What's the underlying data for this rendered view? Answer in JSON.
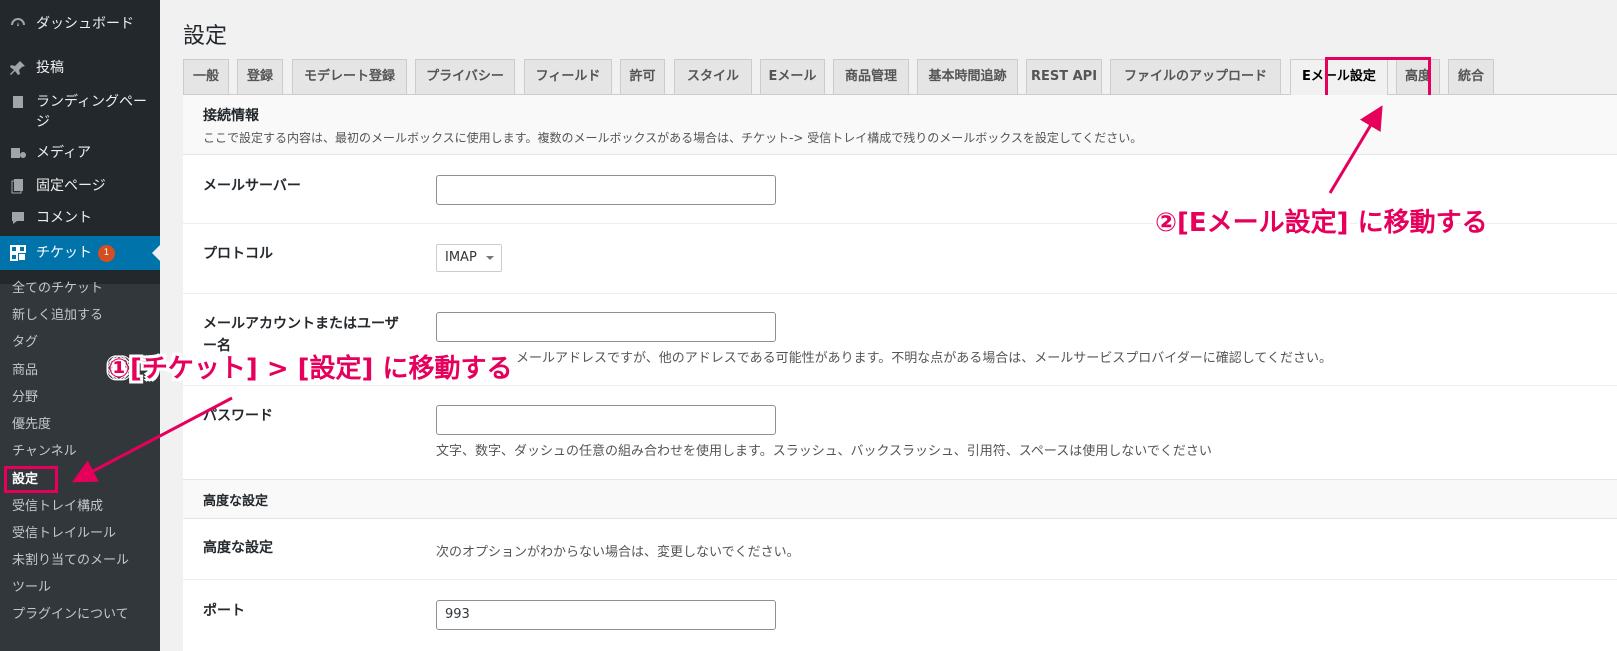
{
  "sidebar": {
    "items": [
      {
        "label": "ダッシュボード",
        "icon": "dashboard-icon"
      },
      {
        "label": "投稿",
        "icon": "pin-icon"
      },
      {
        "label": "ランディングページ",
        "icon": "page-icon"
      },
      {
        "label": "メディア",
        "icon": "media-icon"
      },
      {
        "label": "固定ページ",
        "icon": "pages-icon"
      },
      {
        "label": "コメント",
        "icon": "comment-icon"
      },
      {
        "label": "チケット",
        "icon": "ticket-icon",
        "badge": "1"
      }
    ],
    "submenu": [
      "全てのチケット",
      "新しく追加する",
      "タグ",
      "商品",
      "分野",
      "優先度",
      "チャンネル",
      "設定",
      "受信トレイ構成",
      "受信トレイルール",
      "未割り当てのメール",
      "ツール",
      "プラグインについて"
    ]
  },
  "page": {
    "title": "設定"
  },
  "tabs": [
    "一般",
    "登録",
    "モデレート登録",
    "プライバシー",
    "フィールド",
    "許可",
    "スタイル",
    "Eメール",
    "商品管理",
    "基本時間追跡",
    "REST API",
    "ファイルのアップロード",
    "Eメール設定",
    "高度",
    "統合"
  ],
  "active_tab": "Eメール設定",
  "sections": {
    "connection": {
      "title": "接続情報",
      "desc": "ここで設定する内容は、最初のメールボックスに使用します。複数のメールボックスがある場合は、チケット-> 受信トレイ構成で残りのメールボックスを設定してください。"
    },
    "advanced": {
      "title": "高度な設定"
    }
  },
  "fields": {
    "mail_server": {
      "label": "メールサーバー",
      "value": ""
    },
    "protocol": {
      "label": "プロトコル",
      "value": "IMAP"
    },
    "account": {
      "label": "メールアカウントまたはユーザー名",
      "value": "",
      "help": "、メールアドレスですが、他のアドレスである可能性があります。不明な点がある場合は、メールサービスプロバイダーに確認してください。"
    },
    "password": {
      "label": "パスワード",
      "value": "",
      "help": "文字、数字、ダッシュの任意の組み合わせを使用します。スラッシュ、バックスラッシュ、引用符、スペースは使用しないでください"
    },
    "advanced": {
      "label": "高度な設定",
      "help": "次のオプションがわからない場合は、変更しないでください。"
    },
    "port": {
      "label": "ポート",
      "value": "993"
    }
  },
  "annotations": {
    "step1": "①[チケット] > [設定] に移動する",
    "step2": "②[Eメール設定] に移動する",
    "color": "#e6005c"
  }
}
